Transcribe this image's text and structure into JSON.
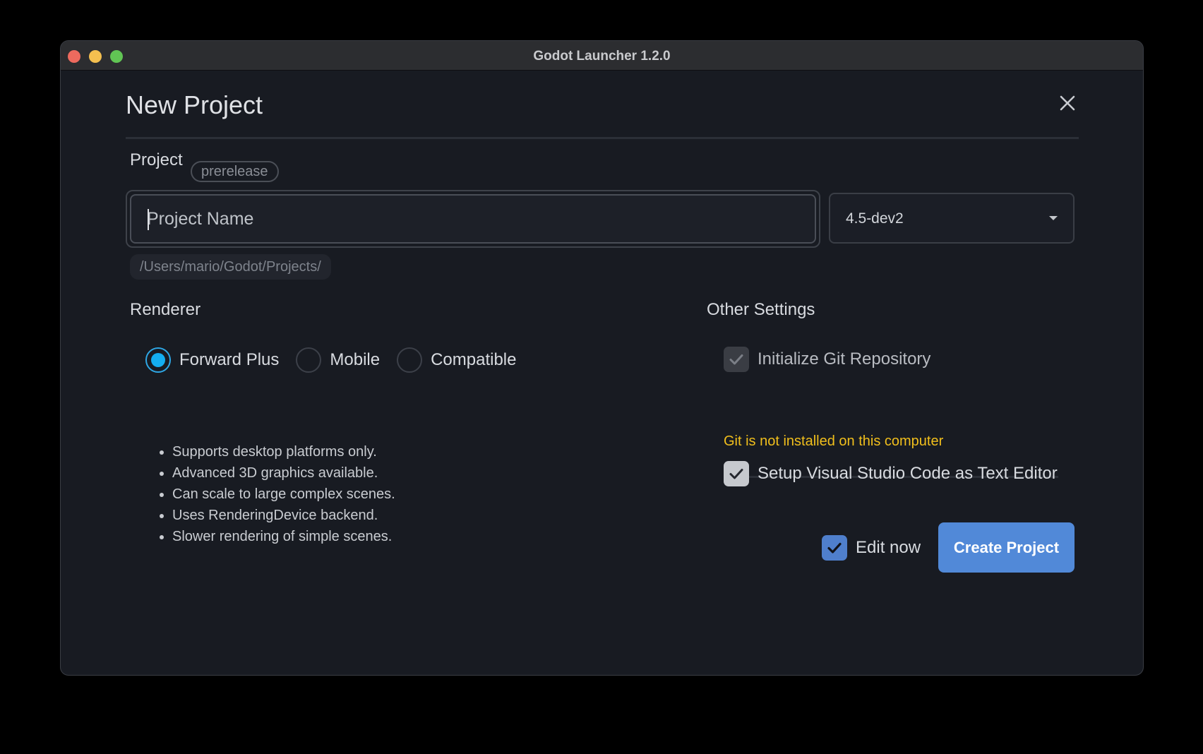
{
  "window": {
    "title": "Godot Launcher 1.2.0"
  },
  "dialog": {
    "title": "New Project"
  },
  "project": {
    "label": "Project",
    "badge": "prerelease",
    "name_placeholder": "Project Name",
    "name_value": "",
    "version": "4.5-dev2",
    "path": "/Users/mario/Godot/Projects/"
  },
  "renderer": {
    "label": "Renderer",
    "options": [
      {
        "label": "Forward Plus",
        "selected": true
      },
      {
        "label": "Mobile",
        "selected": false
      },
      {
        "label": "Compatible",
        "selected": false
      }
    ],
    "features": [
      "Supports desktop platforms only.",
      "Advanced 3D graphics available.",
      "Can scale to large complex scenes.",
      "Uses RenderingDevice backend.",
      "Slower rendering of simple scenes."
    ]
  },
  "other_settings": {
    "label": "Other Settings",
    "git": {
      "label": "Initialize Git Repository",
      "checked": true,
      "enabled": false
    },
    "git_warning": "Git is not installed on this computer",
    "vscode": {
      "label": "Setup Visual Studio Code as Text Editor",
      "checked": true
    }
  },
  "footer": {
    "edit_now": {
      "label": "Edit now",
      "checked": true
    },
    "create_label": "Create Project"
  },
  "colors": {
    "accent": "#5189d8",
    "radio_selected": "#14aef0",
    "warning": "#f1bf1c",
    "background": "#181b22"
  }
}
